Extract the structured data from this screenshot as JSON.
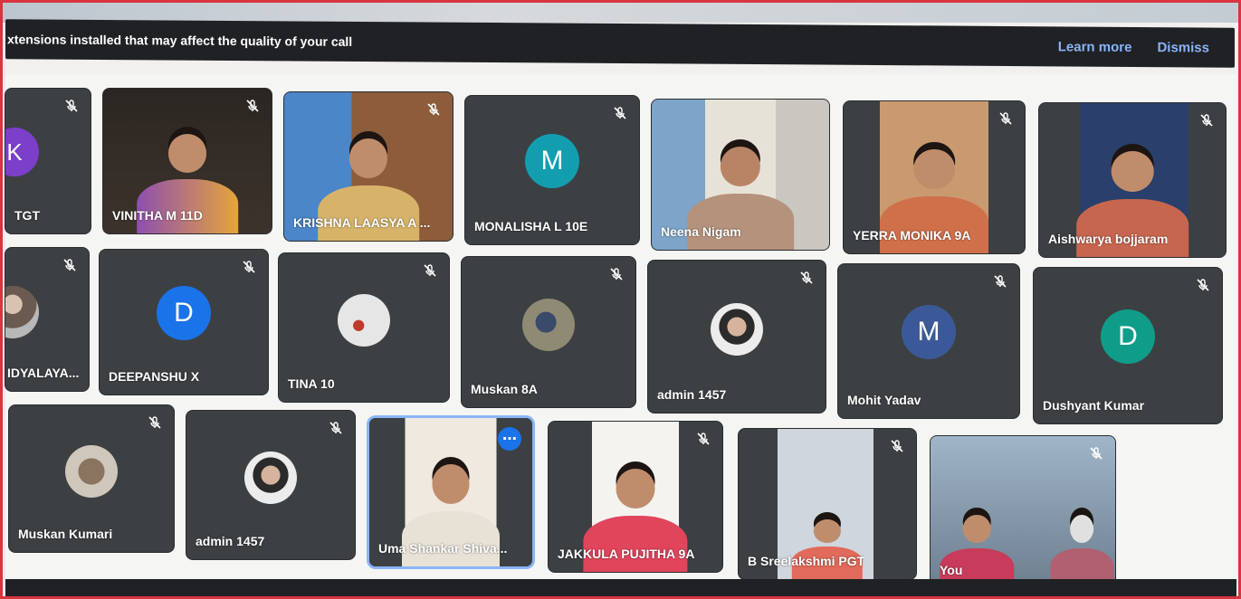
{
  "banner": {
    "message": "xtensions installed that may affect the quality of your call",
    "learn_more": "Learn more",
    "dismiss": "Dismiss"
  },
  "tiles": [
    {
      "name": "TGT",
      "avatar_letter": "K",
      "avatar_color": "#7b3fc9"
    },
    {
      "name": "VINITHA M 11D"
    },
    {
      "name": "KRISHNA LAASYA A ..."
    },
    {
      "name": "MONALISHA L 10E",
      "avatar_letter": "M",
      "avatar_color": "#129eaf"
    },
    {
      "name": "Neena Nigam"
    },
    {
      "name": "YERRA MONIKA 9A"
    },
    {
      "name": "Aishwarya bojjaram"
    },
    {
      "name": "IDYALAYA..."
    },
    {
      "name": "DEEPANSHU X",
      "avatar_letter": "D",
      "avatar_color": "#1a73e8"
    },
    {
      "name": "TINA 10"
    },
    {
      "name": "Muskan 8A"
    },
    {
      "name": "admin 1457"
    },
    {
      "name": "Mohit Yadav",
      "avatar_letter": "M",
      "avatar_color": "#3b5998"
    },
    {
      "name": "Dushyant Kumar",
      "avatar_letter": "D",
      "avatar_color": "#0f9d8a"
    },
    {
      "name": "Muskan Kumari"
    },
    {
      "name": "admin 1457"
    },
    {
      "name": "Uma Shankar Shiva..."
    },
    {
      "name": "JAKKULA PUJITHA 9A"
    },
    {
      "name": "B Sreelakshmi PGT"
    },
    {
      "name": "You"
    }
  ],
  "colors": {
    "tile_bg": "#3c4043",
    "banner_bg": "#202124",
    "link": "#8ab4f8",
    "active_border": "#8ab4f8",
    "more_button": "#1a73e8"
  },
  "icons": {
    "mic_off": "mic-off-icon",
    "more_options": "more-options-icon"
  }
}
